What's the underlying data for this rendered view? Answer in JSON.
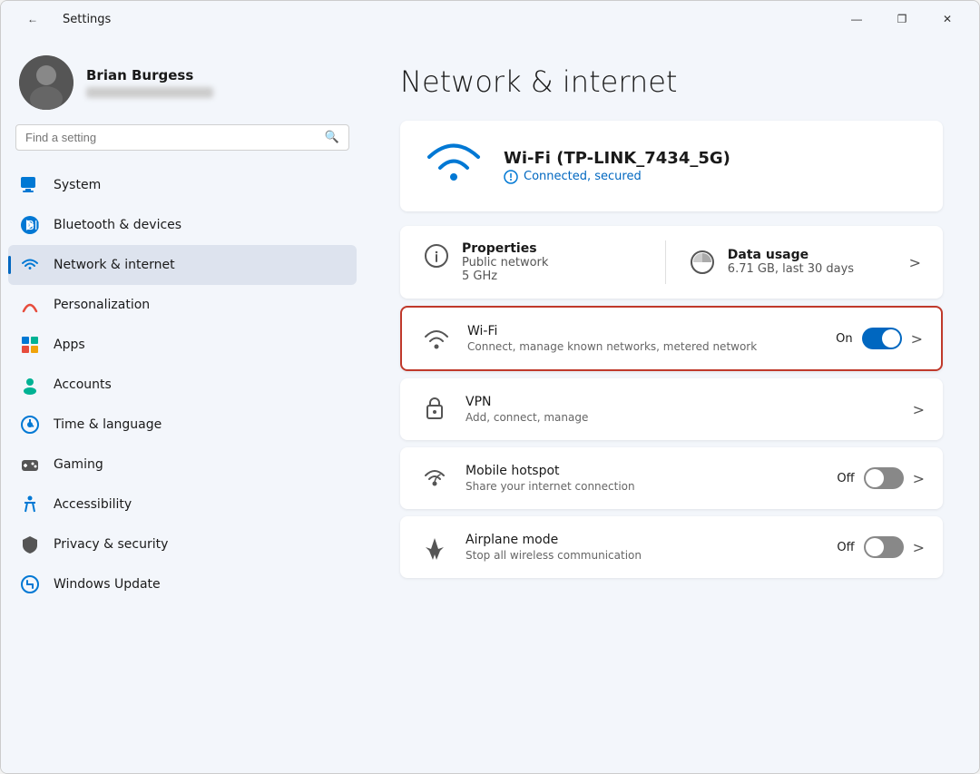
{
  "window": {
    "title": "Settings",
    "controls": {
      "minimize": "—",
      "maximize": "❐",
      "close": "✕"
    }
  },
  "user": {
    "name": "Brian Burgess",
    "avatar_alt": "Brian Burgess avatar"
  },
  "search": {
    "placeholder": "Find a setting"
  },
  "nav": {
    "items": [
      {
        "id": "system",
        "label": "System",
        "icon": "system-icon"
      },
      {
        "id": "bluetooth",
        "label": "Bluetooth & devices",
        "icon": "bluetooth-icon"
      },
      {
        "id": "network",
        "label": "Network & internet",
        "icon": "network-icon",
        "active": true
      },
      {
        "id": "personalization",
        "label": "Personalization",
        "icon": "personalization-icon"
      },
      {
        "id": "apps",
        "label": "Apps",
        "icon": "apps-icon"
      },
      {
        "id": "accounts",
        "label": "Accounts",
        "icon": "accounts-icon"
      },
      {
        "id": "time",
        "label": "Time & language",
        "icon": "time-icon"
      },
      {
        "id": "gaming",
        "label": "Gaming",
        "icon": "gaming-icon"
      },
      {
        "id": "accessibility",
        "label": "Accessibility",
        "icon": "accessibility-icon"
      },
      {
        "id": "privacy",
        "label": "Privacy & security",
        "icon": "privacy-icon"
      },
      {
        "id": "windows-update",
        "label": "Windows Update",
        "icon": "update-icon"
      }
    ]
  },
  "page": {
    "title": "Network & internet",
    "wifi_hero": {
      "name": "Wi-Fi (TP-LINK_7434_5G)",
      "status": "Connected, secured"
    },
    "properties": {
      "label": "Properties",
      "sub1": "Public network",
      "sub2": "5 GHz"
    },
    "data_usage": {
      "label": "Data usage",
      "sub": "6.71 GB, last 30 days"
    },
    "settings_rows": [
      {
        "id": "wifi",
        "title": "Wi-Fi",
        "sub": "Connect, manage known networks, metered network",
        "toggle": true,
        "toggle_state": "on",
        "toggle_label": "On",
        "highlighted": true
      },
      {
        "id": "vpn",
        "title": "VPN",
        "sub": "Add, connect, manage",
        "toggle": false,
        "highlighted": false
      },
      {
        "id": "hotspot",
        "title": "Mobile hotspot",
        "sub": "Share your internet connection",
        "toggle": true,
        "toggle_state": "off",
        "toggle_label": "Off",
        "highlighted": false
      },
      {
        "id": "airplane",
        "title": "Airplane mode",
        "sub": "Stop all wireless communication",
        "toggle": true,
        "toggle_state": "off",
        "toggle_label": "Off",
        "highlighted": false
      }
    ]
  }
}
